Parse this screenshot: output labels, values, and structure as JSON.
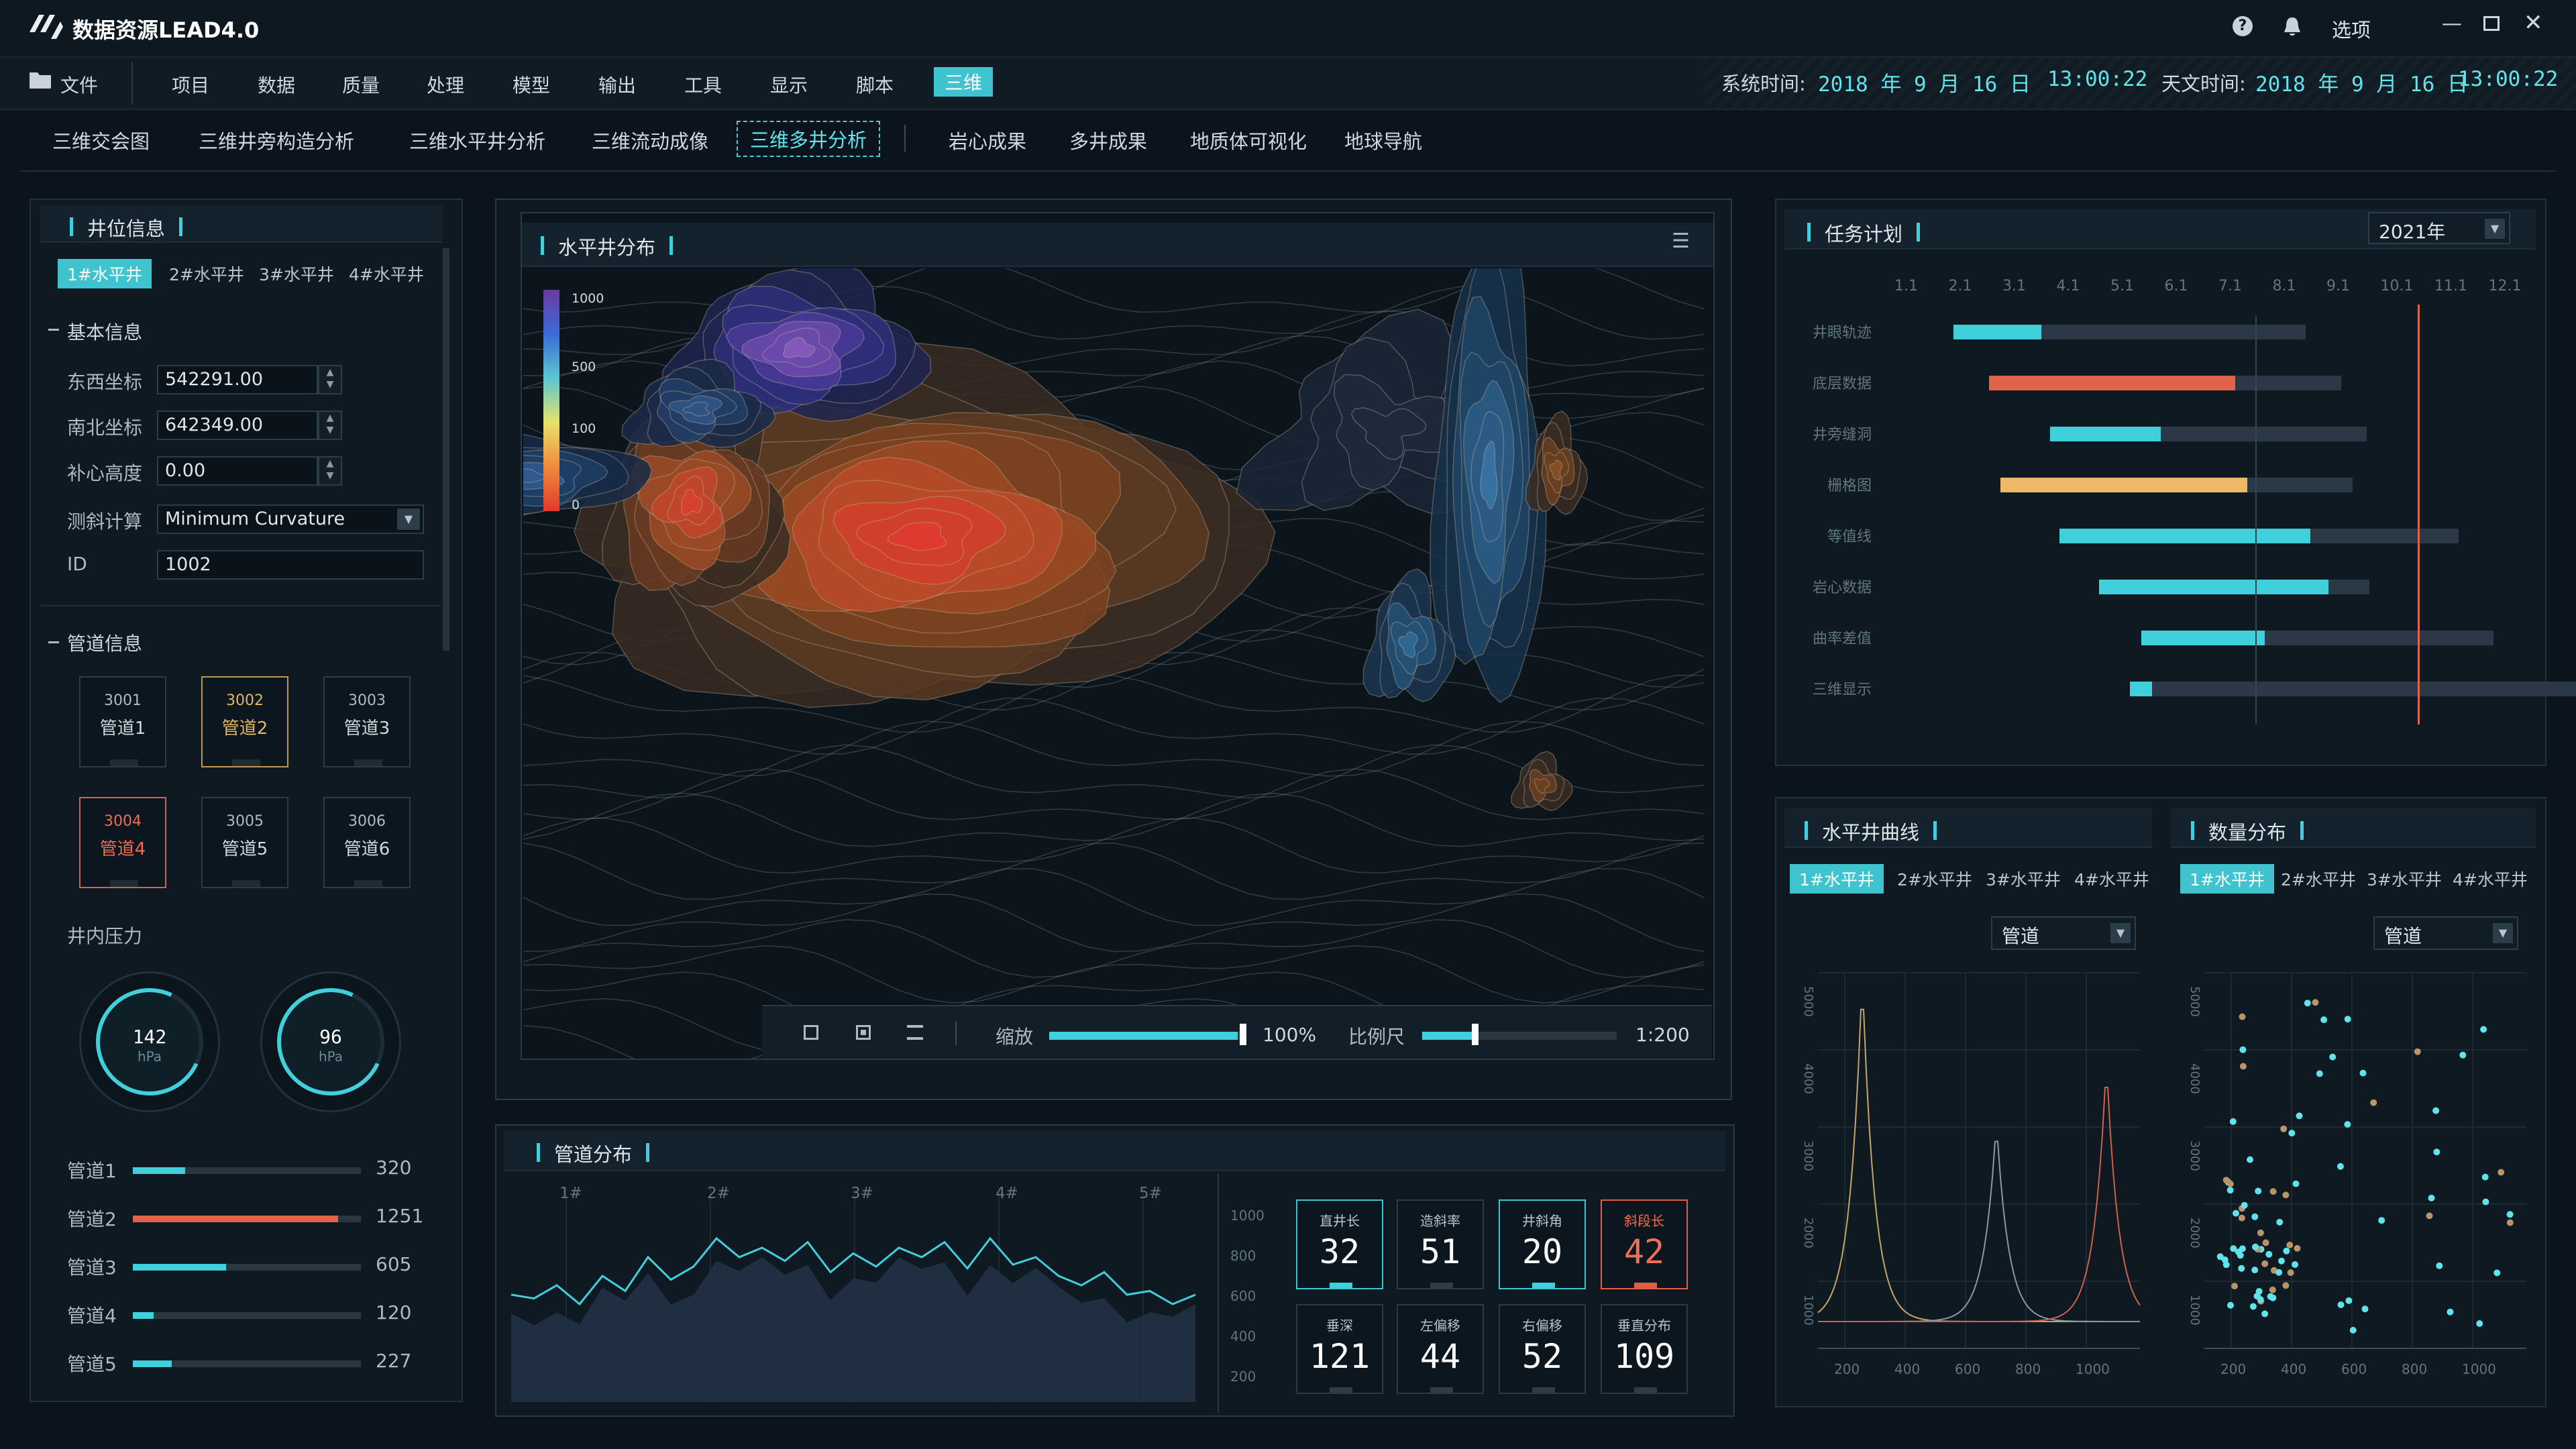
{
  "app": {
    "title": "数据资源LEAD4.0",
    "options": "选项"
  },
  "menu": {
    "file": "文件",
    "items": [
      "项目",
      "数据",
      "质量",
      "处理",
      "模型",
      "输出",
      "工具",
      "显示",
      "脚本",
      "三维"
    ],
    "sys_time_label": "系统时间:",
    "sys_date": "2018 年 9 月 16 日",
    "sys_clock": "13:00:22",
    "astro_time_label": "天文时间:",
    "astro_date": "2018 年 9 月 16 日",
    "astro_clock": "13:00:22"
  },
  "subtabs": [
    "三维交会图",
    "三维井旁构造分析",
    "三维水平井分析",
    "三维流动成像",
    "三维多井分析",
    "岩心成果",
    "多井成果",
    "地质体可视化",
    "地球导航"
  ],
  "well": {
    "title": "井位信息",
    "tabs": [
      "1#水平井",
      "2#水平井",
      "3#水平井",
      "4#水平井"
    ],
    "basic": "基本信息",
    "east_l": "东西坐标",
    "east_v": "542291.00",
    "north_l": "南北坐标",
    "north_v": "642349.00",
    "kb_l": "补心高度",
    "kb_v": "0.00",
    "calc_l": "测斜计算",
    "calc_v": "Minimum Curvature",
    "id_l": "ID",
    "id_v": "1002",
    "pipes_title": "管道信息",
    "pipes": [
      {
        "n": "3001",
        "t": "管道1"
      },
      {
        "n": "3002",
        "t": "管道2"
      },
      {
        "n": "3003",
        "t": "管道3"
      },
      {
        "n": "3004",
        "t": "管道4"
      },
      {
        "n": "3005",
        "t": "管道5"
      },
      {
        "n": "3006",
        "t": "管道6"
      }
    ],
    "pressure_title": "井内压力",
    "g1": "142",
    "g2": "96",
    "unit": "hPa",
    "bars": [
      {
        "l": "管道1",
        "v": "320",
        "f": 0.23
      },
      {
        "l": "管道2",
        "v": "1251",
        "f": 0.9
      },
      {
        "l": "管道3",
        "v": "605",
        "f": 0.41
      },
      {
        "l": "管道4",
        "v": "120",
        "f": 0.09
      },
      {
        "l": "管道5",
        "v": "227",
        "f": 0.17
      }
    ]
  },
  "map": {
    "title": "水平井分布",
    "legend": [
      "1000",
      "500",
      "100",
      "0"
    ],
    "zoom_l": "缩放",
    "zoom_v": "100%",
    "zoom_f": 0.97,
    "scale_l": "比例尺",
    "scale_v": "1:200",
    "scale_f": 0.27
  },
  "pipeline": {
    "title": "管道分布",
    "ticks": [
      "1#",
      "2#",
      "3#",
      "4#",
      "5#"
    ],
    "yticks": [
      "1000",
      "800",
      "600",
      "400",
      "200"
    ],
    "kpis": [
      {
        "k": "直井长",
        "v": "32"
      },
      {
        "k": "造斜率",
        "v": "51"
      },
      {
        "k": "井斜角",
        "v": "20"
      },
      {
        "k": "斜段长",
        "v": "42"
      },
      {
        "k": "垂深",
        "v": "121"
      },
      {
        "k": "左偏移",
        "v": "44"
      },
      {
        "k": "右偏移",
        "v": "52"
      },
      {
        "k": "垂直分布",
        "v": "109"
      }
    ]
  },
  "task": {
    "title": "任务计划",
    "year": "2021年",
    "months": [
      "1.1",
      "2.1",
      "3.1",
      "4.1",
      "5.1",
      "6.1",
      "7.1",
      "8.1",
      "9.1",
      "10.1",
      "11.1",
      "12.1"
    ],
    "rows": [
      "井眼轨迹",
      "底层数据",
      "井旁缝洞",
      "栅格图",
      "等值线",
      "岩心数据",
      "曲率差值",
      "三维显示"
    ]
  },
  "curve": {
    "title": "水平井曲线",
    "tabs": [
      "1#水平井",
      "2#水平井",
      "3#水平井",
      "4#水平井"
    ],
    "sel": "管道",
    "y": [
      "5000",
      "4000",
      "3000",
      "2000",
      "1000"
    ],
    "x": [
      "200",
      "400",
      "600",
      "800",
      "1000"
    ]
  },
  "qty": {
    "title": "数量分布",
    "tabs": [
      "1#水平井",
      "2#水平井",
      "3#水平井",
      "4#水平井"
    ],
    "sel": "管道",
    "y": [
      "5000",
      "4000",
      "3000",
      "2000",
      "1000"
    ],
    "x": [
      "200",
      "400",
      "600",
      "800",
      "1000"
    ]
  }
}
